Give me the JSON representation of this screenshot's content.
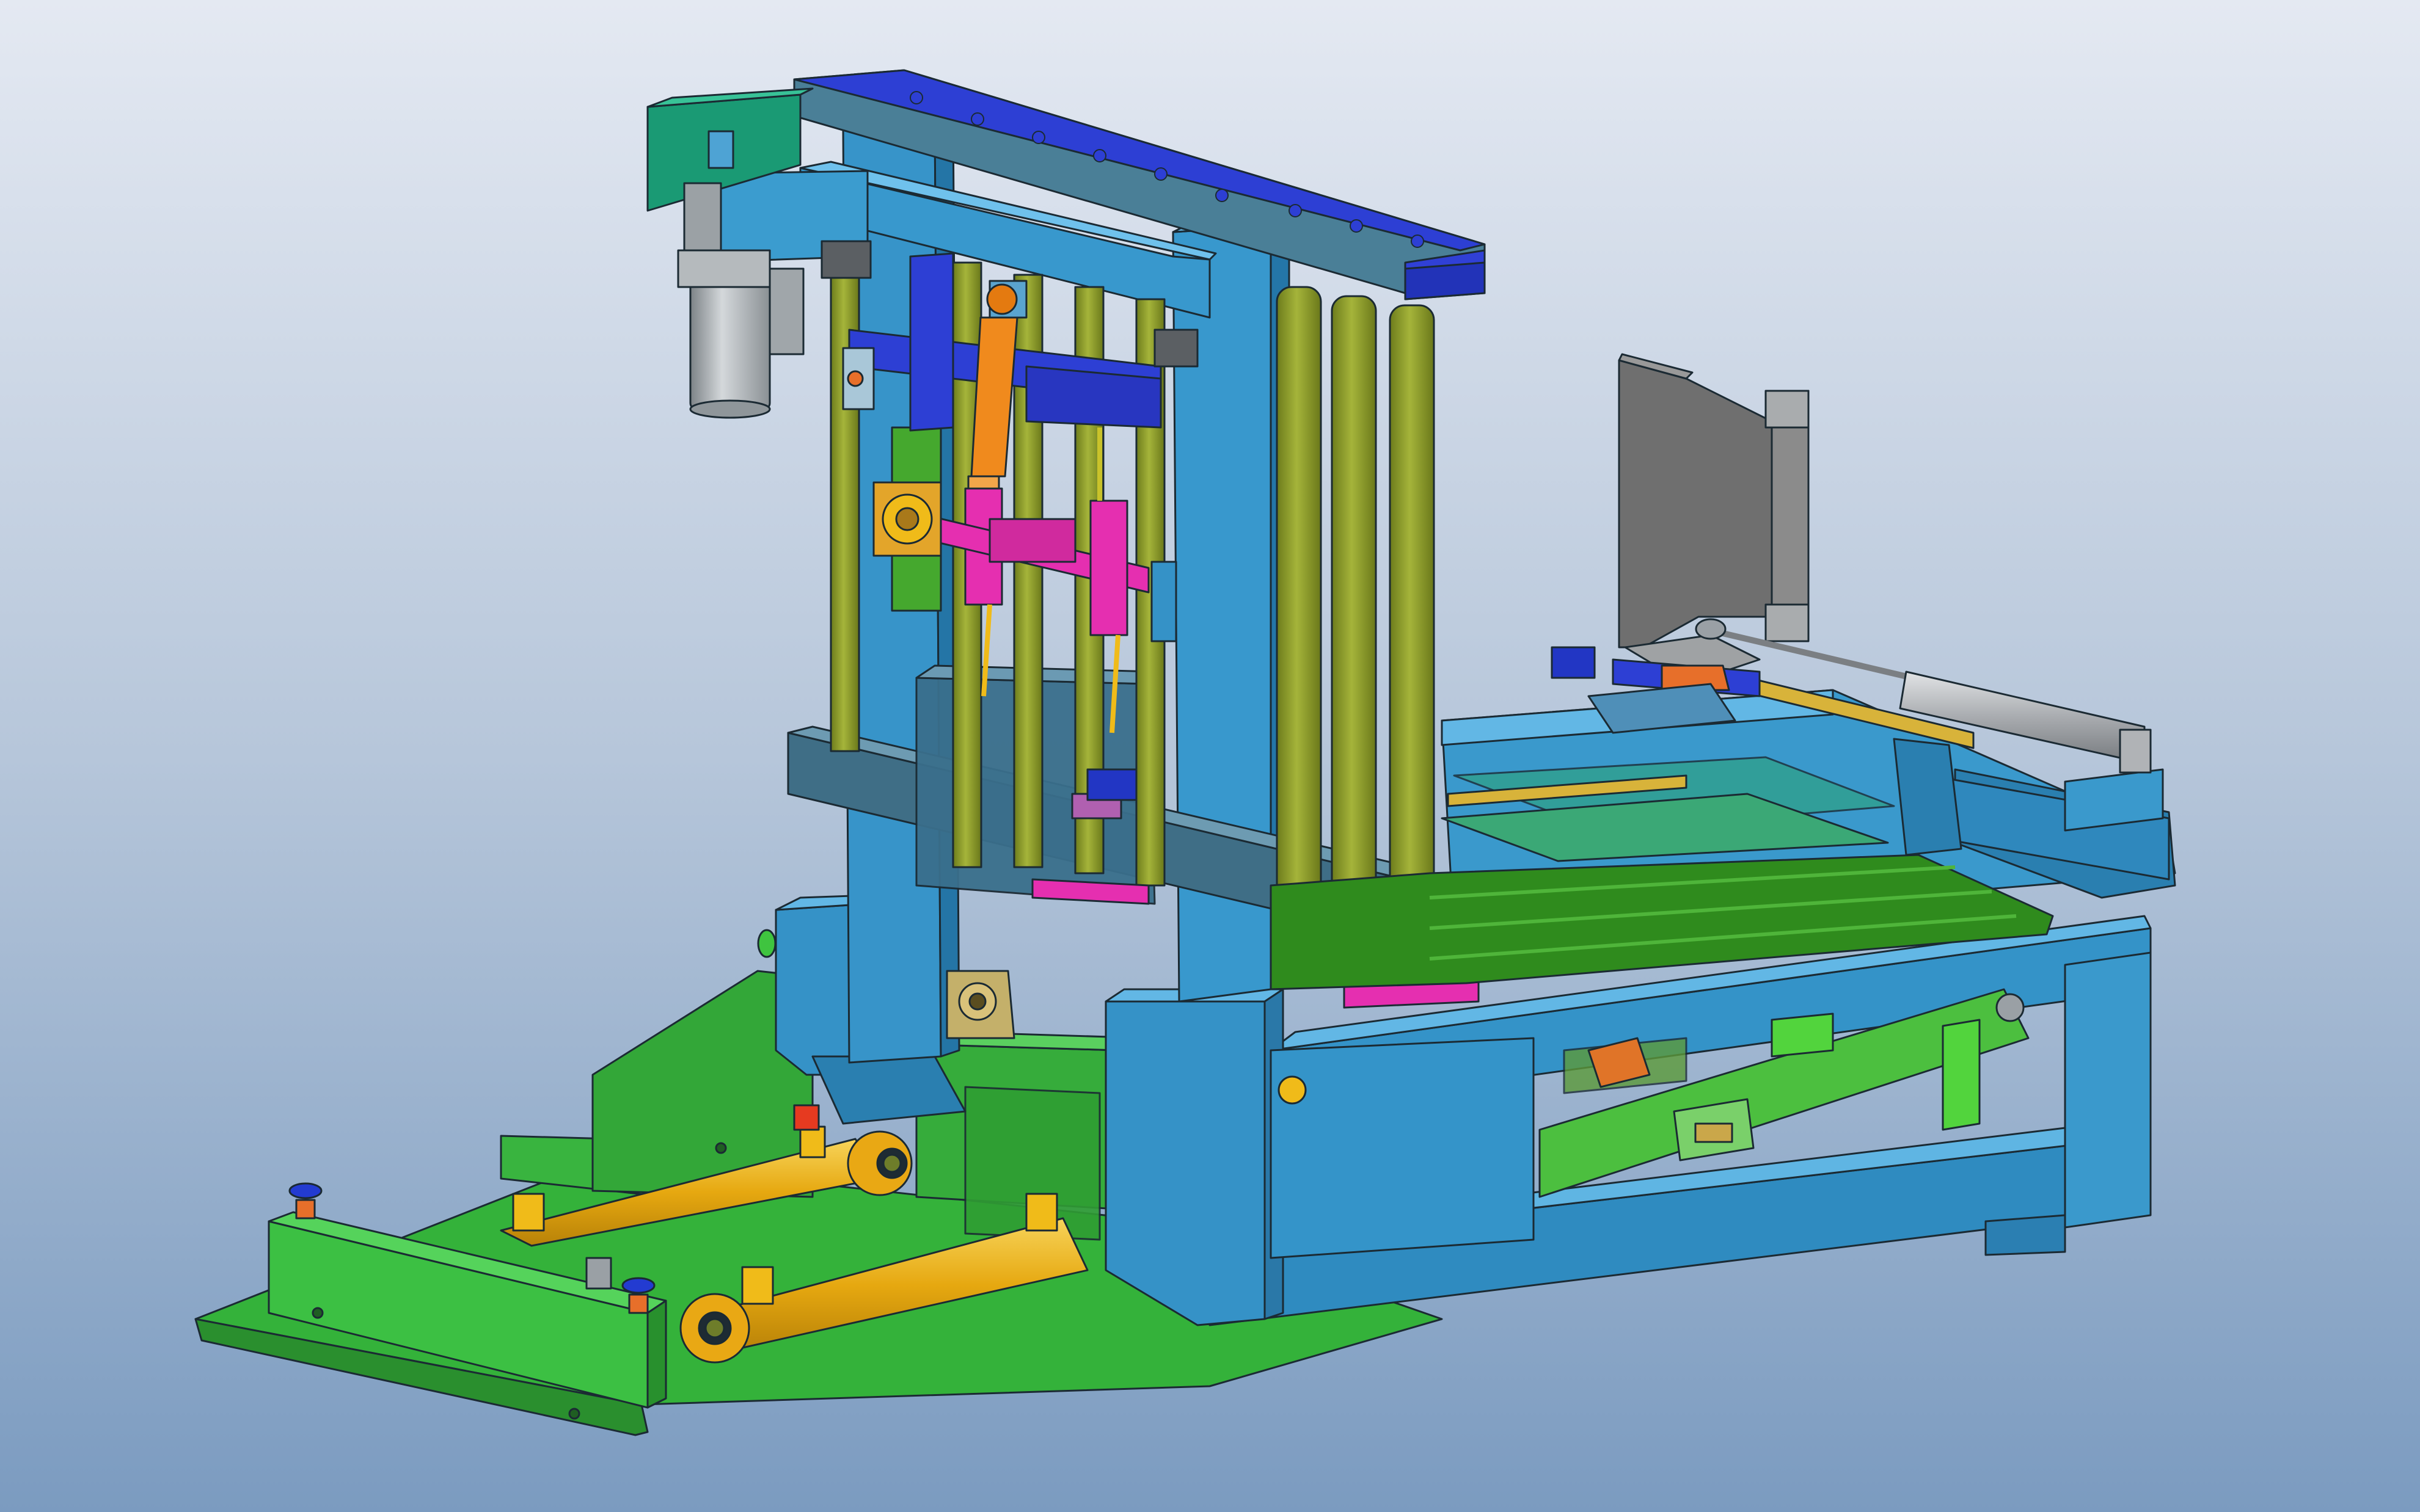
{
  "scene": {
    "kind": "3D CAD assembly view",
    "background_top": "#e3e8f2",
    "background_bottom": "#7d9dc1",
    "parts": [
      {
        "name": "gear-motor",
        "color": "#1a9a74"
      },
      {
        "name": "electric-motor",
        "color": "#9ea4a8"
      },
      {
        "name": "main-frame",
        "color": "#3592c7"
      },
      {
        "name": "top-beam",
        "color": "#2d3fd4"
      },
      {
        "name": "rollers",
        "color": "#8fa02a"
      },
      {
        "name": "hydraulic-cylinders",
        "color": "#f0bb19"
      },
      {
        "name": "lift-cylinder",
        "color": "#f08a1d"
      },
      {
        "name": "pivot-arms",
        "color": "#e52fb0"
      },
      {
        "name": "base-platform",
        "color": "#38b83d"
      },
      {
        "name": "side-plate",
        "color": "#6f6f6f"
      },
      {
        "name": "pneumatic-cylinder",
        "color": "#b6b8bc"
      },
      {
        "name": "conveyor-bed",
        "color": "#2f8b1d"
      },
      {
        "name": "guide-rails",
        "color": "#d8b33a"
      }
    ]
  }
}
